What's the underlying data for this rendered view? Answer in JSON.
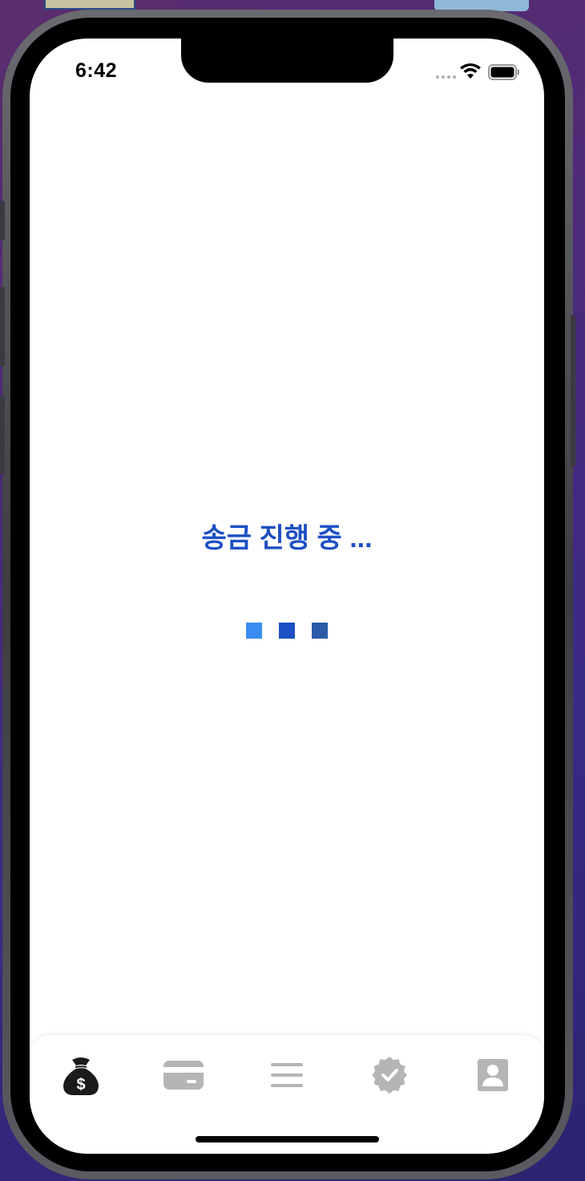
{
  "status_bar": {
    "time": "6:42",
    "icons": [
      "signal-dots-icon",
      "wifi-icon",
      "battery-icon"
    ]
  },
  "main": {
    "title": "송금 진행 중 ...",
    "loader_colors": [
      "#3a8cf0",
      "#1d4fc4",
      "#2a5aa8"
    ]
  },
  "tab_bar": {
    "items": [
      {
        "icon": "money-bag-icon",
        "active": true
      },
      {
        "icon": "credit-card-icon",
        "active": false
      },
      {
        "icon": "menu-icon",
        "active": false
      },
      {
        "icon": "verified-badge-icon",
        "active": false
      },
      {
        "icon": "contact-icon",
        "active": false
      }
    ]
  },
  "colors": {
    "accent": "#1d4fc4",
    "tab_active": "#1a1a1a",
    "tab_inactive": "#b5b5b5"
  }
}
